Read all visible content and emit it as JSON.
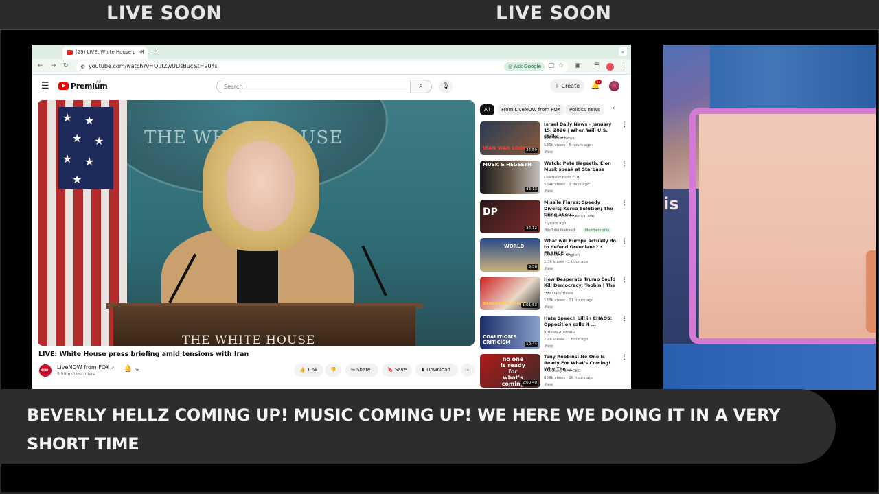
{
  "overlay": {
    "live_soon_left": "LIVE SOON",
    "live_soon_right": "LIVE SOON",
    "ticker": "BEVERLY HELLZ COMING UP! MUSIC COMING UP! WE HERE WE DOING IT IN A VERY SHORT TIME",
    "side_panel_fragment": "is"
  },
  "browser": {
    "tab_title": "(29) LIVE: White House p",
    "tab_audio": "«)",
    "new_tab": "+",
    "url": "youtube.com/watch?v=QufZwUDsBuc&t=904s",
    "ask_google": "Ask Google"
  },
  "youtube": {
    "logo_text": "Premium",
    "region": "AU",
    "search_placeholder": "Search",
    "create_label": "Create",
    "notification_count": "9+",
    "video": {
      "title": "LIVE: White House press briefing amid tensions with Iran",
      "channel": "LiveNOW from FOX",
      "subscribers": "5.59m subscribers",
      "likes": "1.6k",
      "share_label": "Share",
      "save_label": "Save",
      "download_label": "Download",
      "overlay_text": "THE WHITE HOUSE",
      "seal_text": "THE WHITE HOUSE"
    },
    "chips": [
      "All",
      "From LiveNOW from FOX",
      "Politics news"
    ],
    "recommendations": [
      {
        "title": "Israel Daily News - January 15, 2026 | When Will U.S. Strike ...",
        "channel": "ILTV Israel News",
        "meta": "136k views · 5 hours ago",
        "badge": "New",
        "duration": "24:59",
        "thumb_text": "IRAN WAR LOOMS"
      },
      {
        "title": "Watch: Pete Hegseth, Elon Musk speak at Starbase",
        "channel": "LiveNOW from FOX",
        "meta": "564k views · 3 days ago",
        "badge": "New",
        "duration": "43:13",
        "thumb_text": "MUSK & HEGSETH"
      },
      {
        "title": "Missile Flares; Speedy Divers; Korea Solution; The thing abou...",
        "channel": "Defense Politics Asia (DPA)",
        "meta": "2 years ago",
        "badge": "YouTube featured",
        "members": "Members only",
        "duration": "34:12",
        "thumb_text": "DP"
      },
      {
        "title": "What will Europe actually do to defend Greenland? • FRANCE ...",
        "channel": "FRANCE 24 English",
        "meta": "1.3k views · 1 hour ago",
        "badge": "New",
        "duration": "9:56",
        "thumb_text": "WORLD"
      },
      {
        "title": "How Desperate Trump Could Kill Democracy: Toobin | The ...",
        "channel": "The Daily Beast",
        "meta": "133k views · 21 hours ago",
        "badge": "New",
        "duration": "1:01:53",
        "thumb_text": "DANGEROUS POWER"
      },
      {
        "title": "Hate Speech bill in CHAOS: Opposition calls it ...",
        "channel": "9 News Australia",
        "meta": "2.4k views · 1 hour ago",
        "badge": "New",
        "duration": "10:44",
        "thumb_text": "COALITION'S CRITICISM"
      },
      {
        "title": "Tony Robbins: No One Is Ready For What's Coming! Why The ...",
        "channel": "The Diary Of A CEO",
        "meta": "839k views · 16 hours ago",
        "badge": "New",
        "duration": "2:00:40",
        "thumb_text": "no one is ready for what's coming"
      }
    ]
  }
}
